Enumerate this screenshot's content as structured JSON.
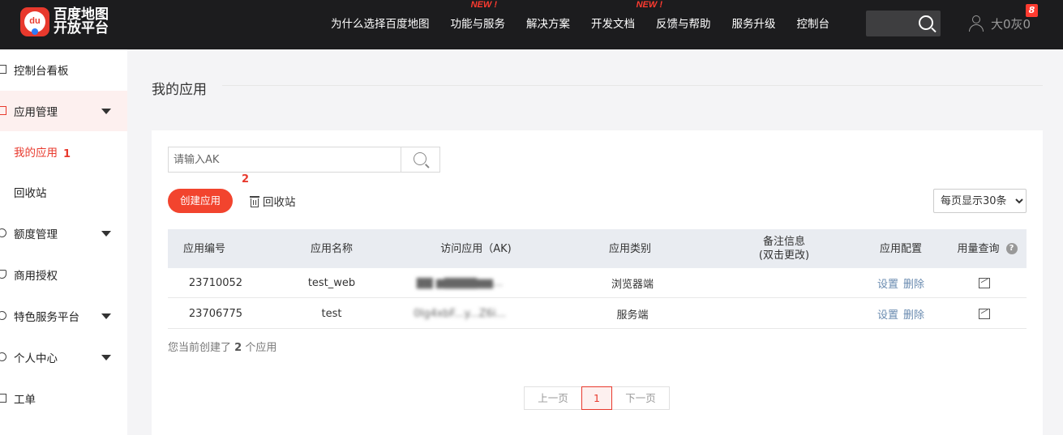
{
  "header": {
    "logo_line1": "百度地图",
    "logo_line2": "开放平台",
    "logo_mark": "du",
    "nav": [
      {
        "label": "为什么选择百度地图",
        "new": ""
      },
      {
        "label": "功能与服务",
        "new": "NEW !"
      },
      {
        "label": "解决方案",
        "new": ""
      },
      {
        "label": "开发文档",
        "new": "NEW !"
      },
      {
        "label": "反馈与帮助",
        "new": ""
      },
      {
        "label": "服务升级",
        "new": ""
      },
      {
        "label": "控制台",
        "new": ""
      }
    ],
    "user_name": "大0灰0",
    "notification_count": "8"
  },
  "sidebar": {
    "items": [
      {
        "label": "控制台看板"
      },
      {
        "label": "应用管理"
      },
      {
        "label": "我的应用"
      },
      {
        "label": "回收站"
      },
      {
        "label": "额度管理"
      },
      {
        "label": "商用授权"
      },
      {
        "label": "特色服务平台"
      },
      {
        "label": "个人中心"
      },
      {
        "label": "工单"
      }
    ]
  },
  "annotations": {
    "one": "1",
    "two": "2"
  },
  "main": {
    "title": "我的应用",
    "search_placeholder": "请输入AK",
    "create_label": "创建应用",
    "recycle_label": "回收站",
    "page_size_option": "每页显示30条",
    "columns": [
      "应用编号",
      "应用名称",
      "访问应用（AK)",
      "应用类别",
      "备注信息",
      "(双击更改)",
      "应用配置",
      "用量查询"
    ],
    "rows": [
      {
        "id": "23710052",
        "name": "test_web",
        "ak": "▇▇ ▆▇▇▇▇▆▆...",
        "category": "浏览器端",
        "note": "",
        "ops": [
          "设置",
          "删除"
        ]
      },
      {
        "id": "23706775",
        "name": "test",
        "ak": "0Ig4xbF...y...Z6i...",
        "category": "服务端",
        "note": "",
        "ops": [
          "设置",
          "删除"
        ]
      }
    ],
    "summary_prefix": "您当前创建了",
    "summary_count": "2",
    "summary_suffix": "个应用",
    "pager": {
      "prev": "上一页",
      "current": "1",
      "next": "下一页"
    }
  },
  "colors": {
    "accent": "#e8392d",
    "topbar": "#1c1c1e",
    "link": "#6a8bb0"
  }
}
